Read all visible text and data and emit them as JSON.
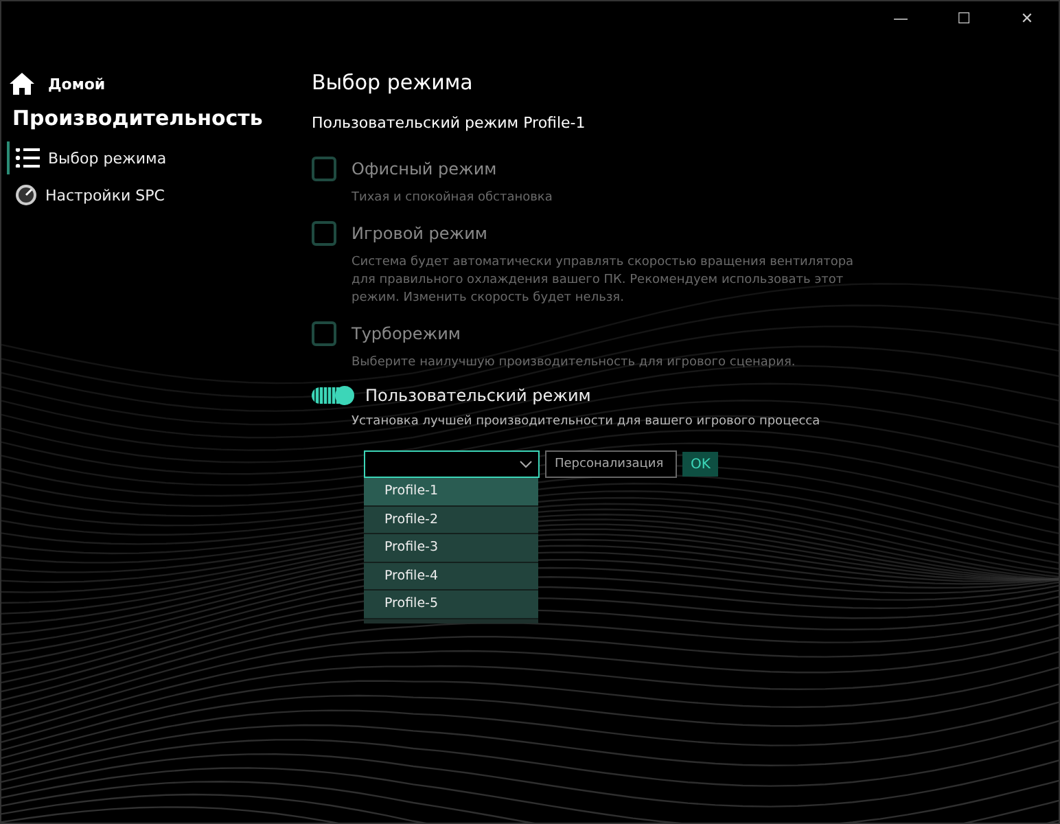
{
  "window": {
    "controls": [
      "—",
      "☐",
      "✕"
    ]
  },
  "sidebar": {
    "home": "Домой",
    "section": "Производительность",
    "items": [
      {
        "label": "Выбор режима",
        "selected": true,
        "kind": "list"
      },
      {
        "label": "Настройки SPC",
        "selected": false,
        "kind": "gauge"
      }
    ]
  },
  "main": {
    "title": "Выбор режима",
    "subtitle": "Пользовательский режим Profile-1",
    "modes": [
      {
        "kind": "checkbox",
        "label": "Офисный режим",
        "checked": false,
        "description": "Тихая и спокойная обстановка"
      },
      {
        "kind": "checkbox",
        "label": "Игровой режим",
        "checked": false,
        "description": "Система будет автоматически управлять скоростью вращения вентилятора для правильного охлаждения вашего ПК. Рекомендуем использовать этот режим. Изменить скорость будет нельзя."
      },
      {
        "kind": "checkbox",
        "label": "Турборежим",
        "checked": false,
        "description": "Выберите наилучшую производительность для игрового сценария."
      },
      {
        "kind": "toggle",
        "label": "Пользовательский режим",
        "on": true,
        "description": "Установка лучшей производительности для вашего игрового процесса"
      }
    ],
    "profile": {
      "expanded": true,
      "options": [
        {
          "label": "Profile-1",
          "selected": true
        },
        {
          "label": "Profile-2",
          "selected": false
        },
        {
          "label": "Profile-3",
          "selected": false
        },
        {
          "label": "Profile-4",
          "selected": false
        },
        {
          "label": "Profile-5",
          "selected": false
        }
      ],
      "name_placeholder": "Персонализация",
      "ok": "OK"
    }
  }
}
